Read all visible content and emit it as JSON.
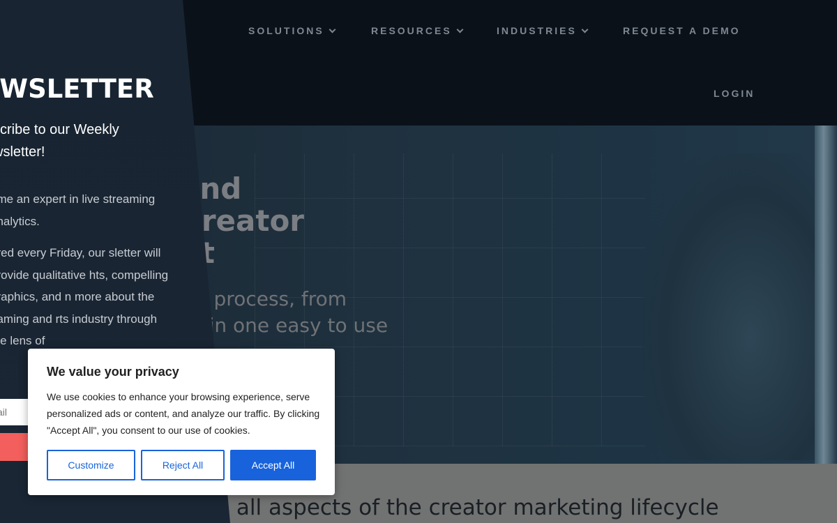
{
  "nav": {
    "items": [
      {
        "label": "SOLUTIONS"
      },
      {
        "label": "RESOURCES"
      },
      {
        "label": "INDUSTRIES"
      },
      {
        "label": "REQUEST A DEMO"
      }
    ],
    "login_label": "LOGIN",
    "icons": {
      "dropdown": "chevron-down-icon"
    }
  },
  "hero": {
    "title_lines": [
      "and",
      "Creator",
      "nt"
    ],
    "subtitle_lines": [
      "tor process, from",
      "all in one easy to use"
    ]
  },
  "lower_band": {
    "text": "e all aspects of the creator marketing lifecycle"
  },
  "newsletter": {
    "title": "EWSLETTER",
    "lead": "scribe to our Weekly wsletter!",
    "body_1": "ome an expert in live streaming analytics.",
    "body_2": "ered every Friday, our sletter will provide qualitative hts, compelling graphics, and n more about the gaming and rts industry through the lens of",
    "email_placeholder": "ail",
    "accent_color": "#f25f5c"
  },
  "cookie": {
    "title": "We value your privacy",
    "text": "We use cookies to enhance your browsing experience, serve personalized ads or content, and analyze our traffic. By clicking \"Accept All\", you consent to our use of cookies.",
    "customize_label": "Customize",
    "reject_label": "Reject All",
    "accept_label": "Accept All",
    "accent_color": "#1863dc"
  }
}
